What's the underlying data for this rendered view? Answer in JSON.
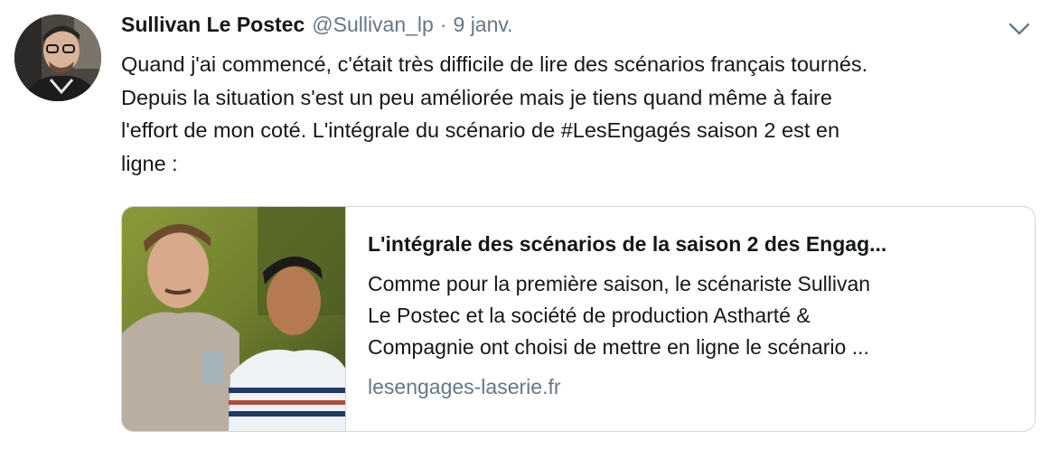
{
  "tweet": {
    "author_name": "Sullivan Le Postec",
    "author_handle": "@Sullivan_lp",
    "separator": "·",
    "timestamp": "9 janv.",
    "text_lines": [
      "Quand j'ai commencé, c'était très difficile de lire des scénarios français tournés.",
      "Depuis la situation s'est un peu améliorée mais je tiens quand même à faire",
      "l'effort de mon coté. L'intégrale du scénario de ",
      " saison 2 est en",
      "ligne :"
    ],
    "hashtag": "#LesEngagés",
    "menu_icon": "chevron-down-icon"
  },
  "card": {
    "title": "L'intégrale des scénarios de la saison 2 des Engag...",
    "description_lines": [
      "Comme pour la première saison, le scénariste Sullivan",
      "Le Postec et la société de production Astharté &",
      "Compagnie ont choisi de mettre en ligne le scénario ..."
    ],
    "domain": "lesengages-laserie.fr",
    "image": "two-young-men-outdoors-photo"
  },
  "colors": {
    "text": "#14171a",
    "secondary": "#657786",
    "border": "#ccd6dd"
  }
}
